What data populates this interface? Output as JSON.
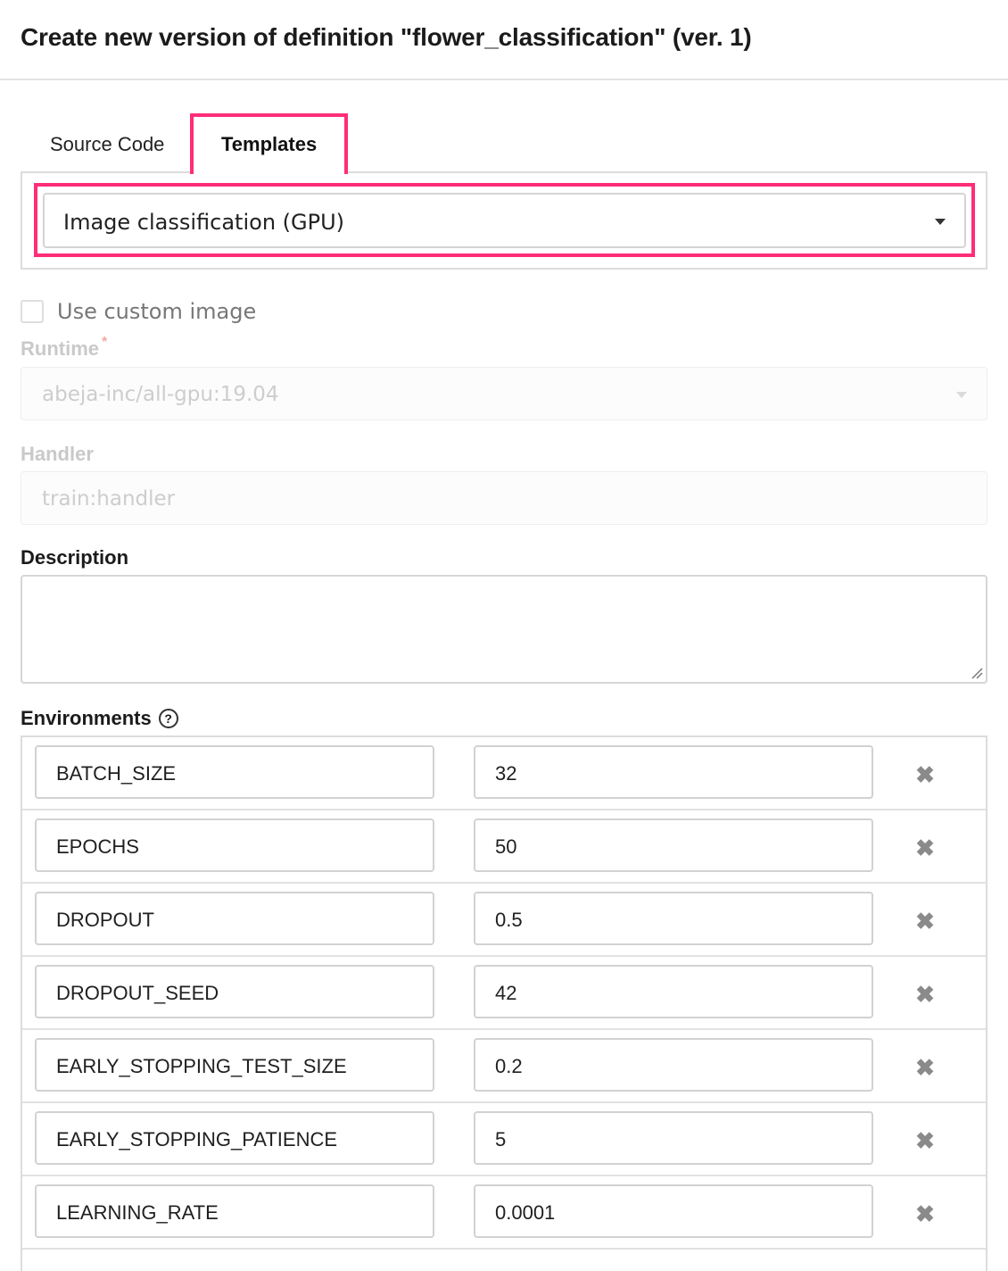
{
  "header": {
    "title": "Create new version of definition \"flower_classification\" (ver. 1)"
  },
  "tabs": {
    "source_code": "Source Code",
    "templates": "Templates",
    "active": "Templates"
  },
  "template_select": {
    "value": "Image classification (GPU)"
  },
  "custom_image": {
    "label": "Use custom image",
    "checked": false
  },
  "runtime": {
    "label": "Runtime",
    "required_mark": "*",
    "value": "abeja-inc/all-gpu:19.04"
  },
  "handler": {
    "label": "Handler",
    "value": "train:handler"
  },
  "description": {
    "label": "Description",
    "value": ""
  },
  "environments": {
    "label": "Environments",
    "help_glyph": "?",
    "remove_glyph": "✖",
    "rows": [
      {
        "key": "BATCH_SIZE",
        "value": "32"
      },
      {
        "key": "EPOCHS",
        "value": "50"
      },
      {
        "key": "DROPOUT",
        "value": "0.5"
      },
      {
        "key": "DROPOUT_SEED",
        "value": "42"
      },
      {
        "key": "EARLY_STOPPING_TEST_SIZE",
        "value": "0.2"
      },
      {
        "key": "EARLY_STOPPING_PATIENCE",
        "value": "5"
      },
      {
        "key": "LEARNING_RATE",
        "value": "0.0001"
      }
    ]
  },
  "colors": {
    "highlight": "#ff2d78",
    "border": "#dcdcdc",
    "disabled_text": "#cdcdcd"
  }
}
